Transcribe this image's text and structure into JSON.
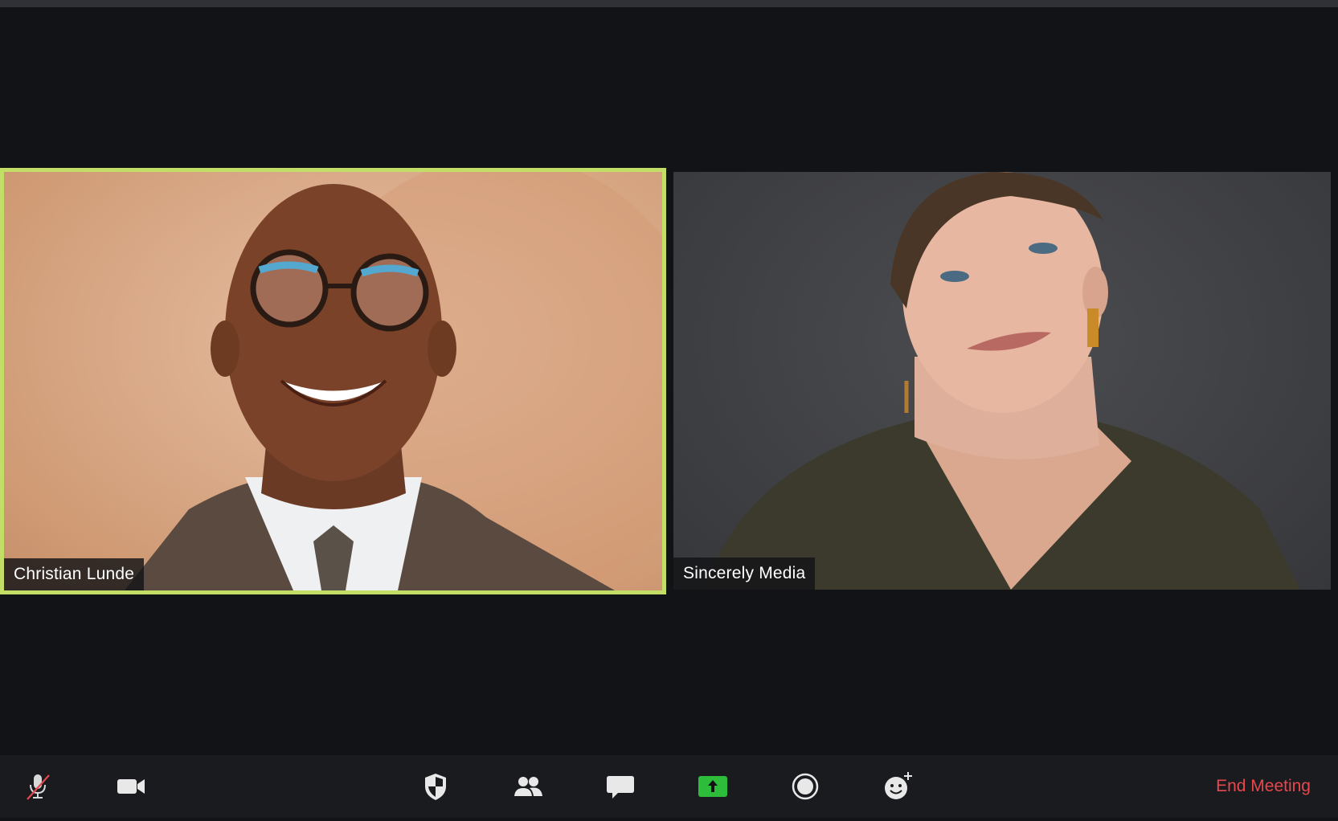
{
  "participants": [
    {
      "name": "Christian Lunde",
      "active_speaker": true
    },
    {
      "name": "Sincerely Media",
      "active_speaker": false
    }
  ],
  "toolbar": {
    "buttons": [
      {
        "icon": "microphone-muted-icon",
        "state": "muted"
      },
      {
        "icon": "video-camera-icon"
      },
      {
        "icon": "security-shield-icon"
      },
      {
        "icon": "participants-icon"
      },
      {
        "icon": "chat-bubble-icon"
      },
      {
        "icon": "share-screen-icon",
        "color": "#2ebd3b"
      },
      {
        "icon": "record-icon"
      },
      {
        "icon": "reactions-icon"
      }
    ],
    "end_meeting_label": "End Meeting"
  },
  "colors": {
    "background": "#121316",
    "toolbar": "#1a1b1f",
    "active_speaker_border": "#c3de67",
    "end_meeting": "#e5484d",
    "share_green": "#2ebd3b"
  }
}
